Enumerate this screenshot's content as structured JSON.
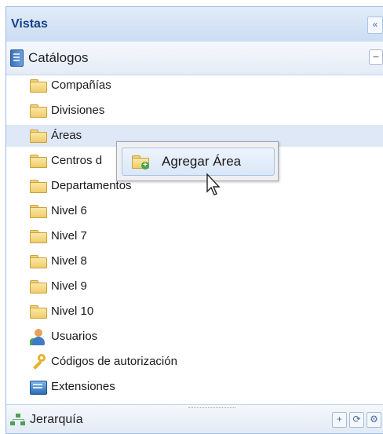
{
  "header": {
    "title": "Vistas",
    "collapse_icon": "double-chevron-left-icon",
    "collapse_label": "«"
  },
  "section": {
    "label": "Catálogos",
    "icon": "catalog-book-icon",
    "toggle_label": "−"
  },
  "tree": {
    "selected_index": 2,
    "items": [
      {
        "label": "Compañías",
        "icon": "folder-icon"
      },
      {
        "label": "Divisiones",
        "icon": "folder-icon"
      },
      {
        "label": "Áreas",
        "icon": "folder-icon"
      },
      {
        "label": "Centros d",
        "icon": "folder-icon"
      },
      {
        "label": "Departamentos",
        "icon": "folder-icon"
      },
      {
        "label": "Nivel 6",
        "icon": "folder-icon"
      },
      {
        "label": "Nivel 7",
        "icon": "folder-icon"
      },
      {
        "label": "Nivel 8",
        "icon": "folder-icon"
      },
      {
        "label": "Nivel 9",
        "icon": "folder-icon"
      },
      {
        "label": "Nivel 10",
        "icon": "folder-icon"
      },
      {
        "label": "Usuarios",
        "icon": "users-icon"
      },
      {
        "label": "Códigos de autorización",
        "icon": "key-icon"
      },
      {
        "label": "Extensiones",
        "icon": "extensions-icon"
      }
    ]
  },
  "context_menu": {
    "item_label": "Agregar Área",
    "icon": "folder-add-icon"
  },
  "footer": {
    "label": "Jerarquía",
    "icon": "hierarchy-icon",
    "buttons": {
      "add": "+",
      "refresh": "⟳",
      "settings": "⚙"
    }
  }
}
